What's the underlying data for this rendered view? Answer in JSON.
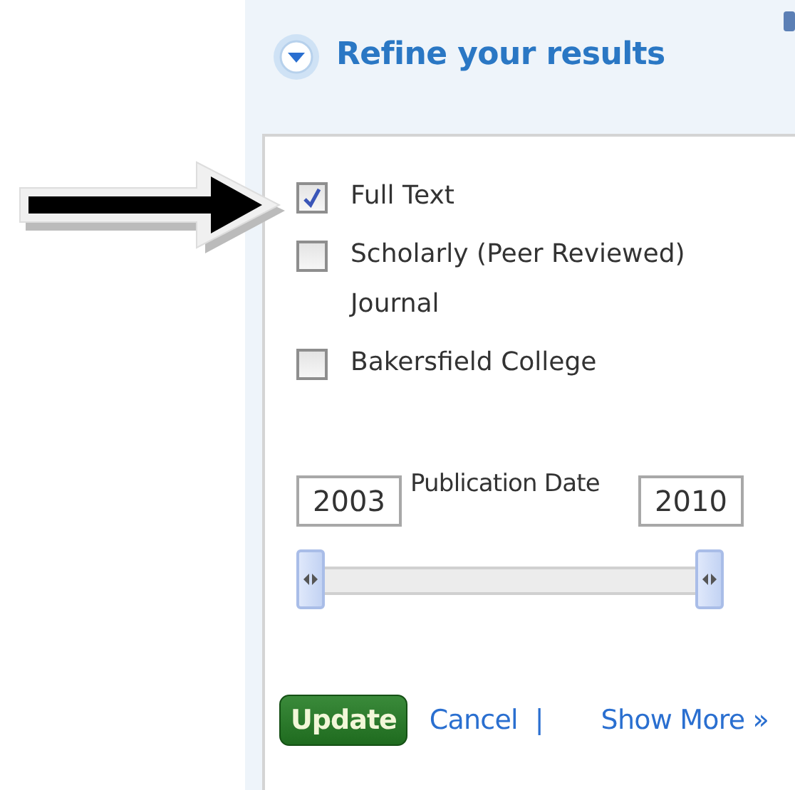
{
  "panel": {
    "title": "Refine your results",
    "expanded": true
  },
  "filters": [
    {
      "label": "Full Text",
      "checked": true
    },
    {
      "label": "Scholarly (Peer Reviewed) Journal",
      "checked": false
    },
    {
      "label": "Bakersfield College",
      "checked": false
    }
  ],
  "date_range": {
    "from": "2003",
    "label": "Publication Date",
    "to": "2010",
    "thumbs": [
      {
        "level": 0
      },
      {
        "level": 1
      }
    ]
  },
  "actions": {
    "update": "Update",
    "cancel": "Cancel",
    "separator": "|",
    "more": "Show More »"
  }
}
